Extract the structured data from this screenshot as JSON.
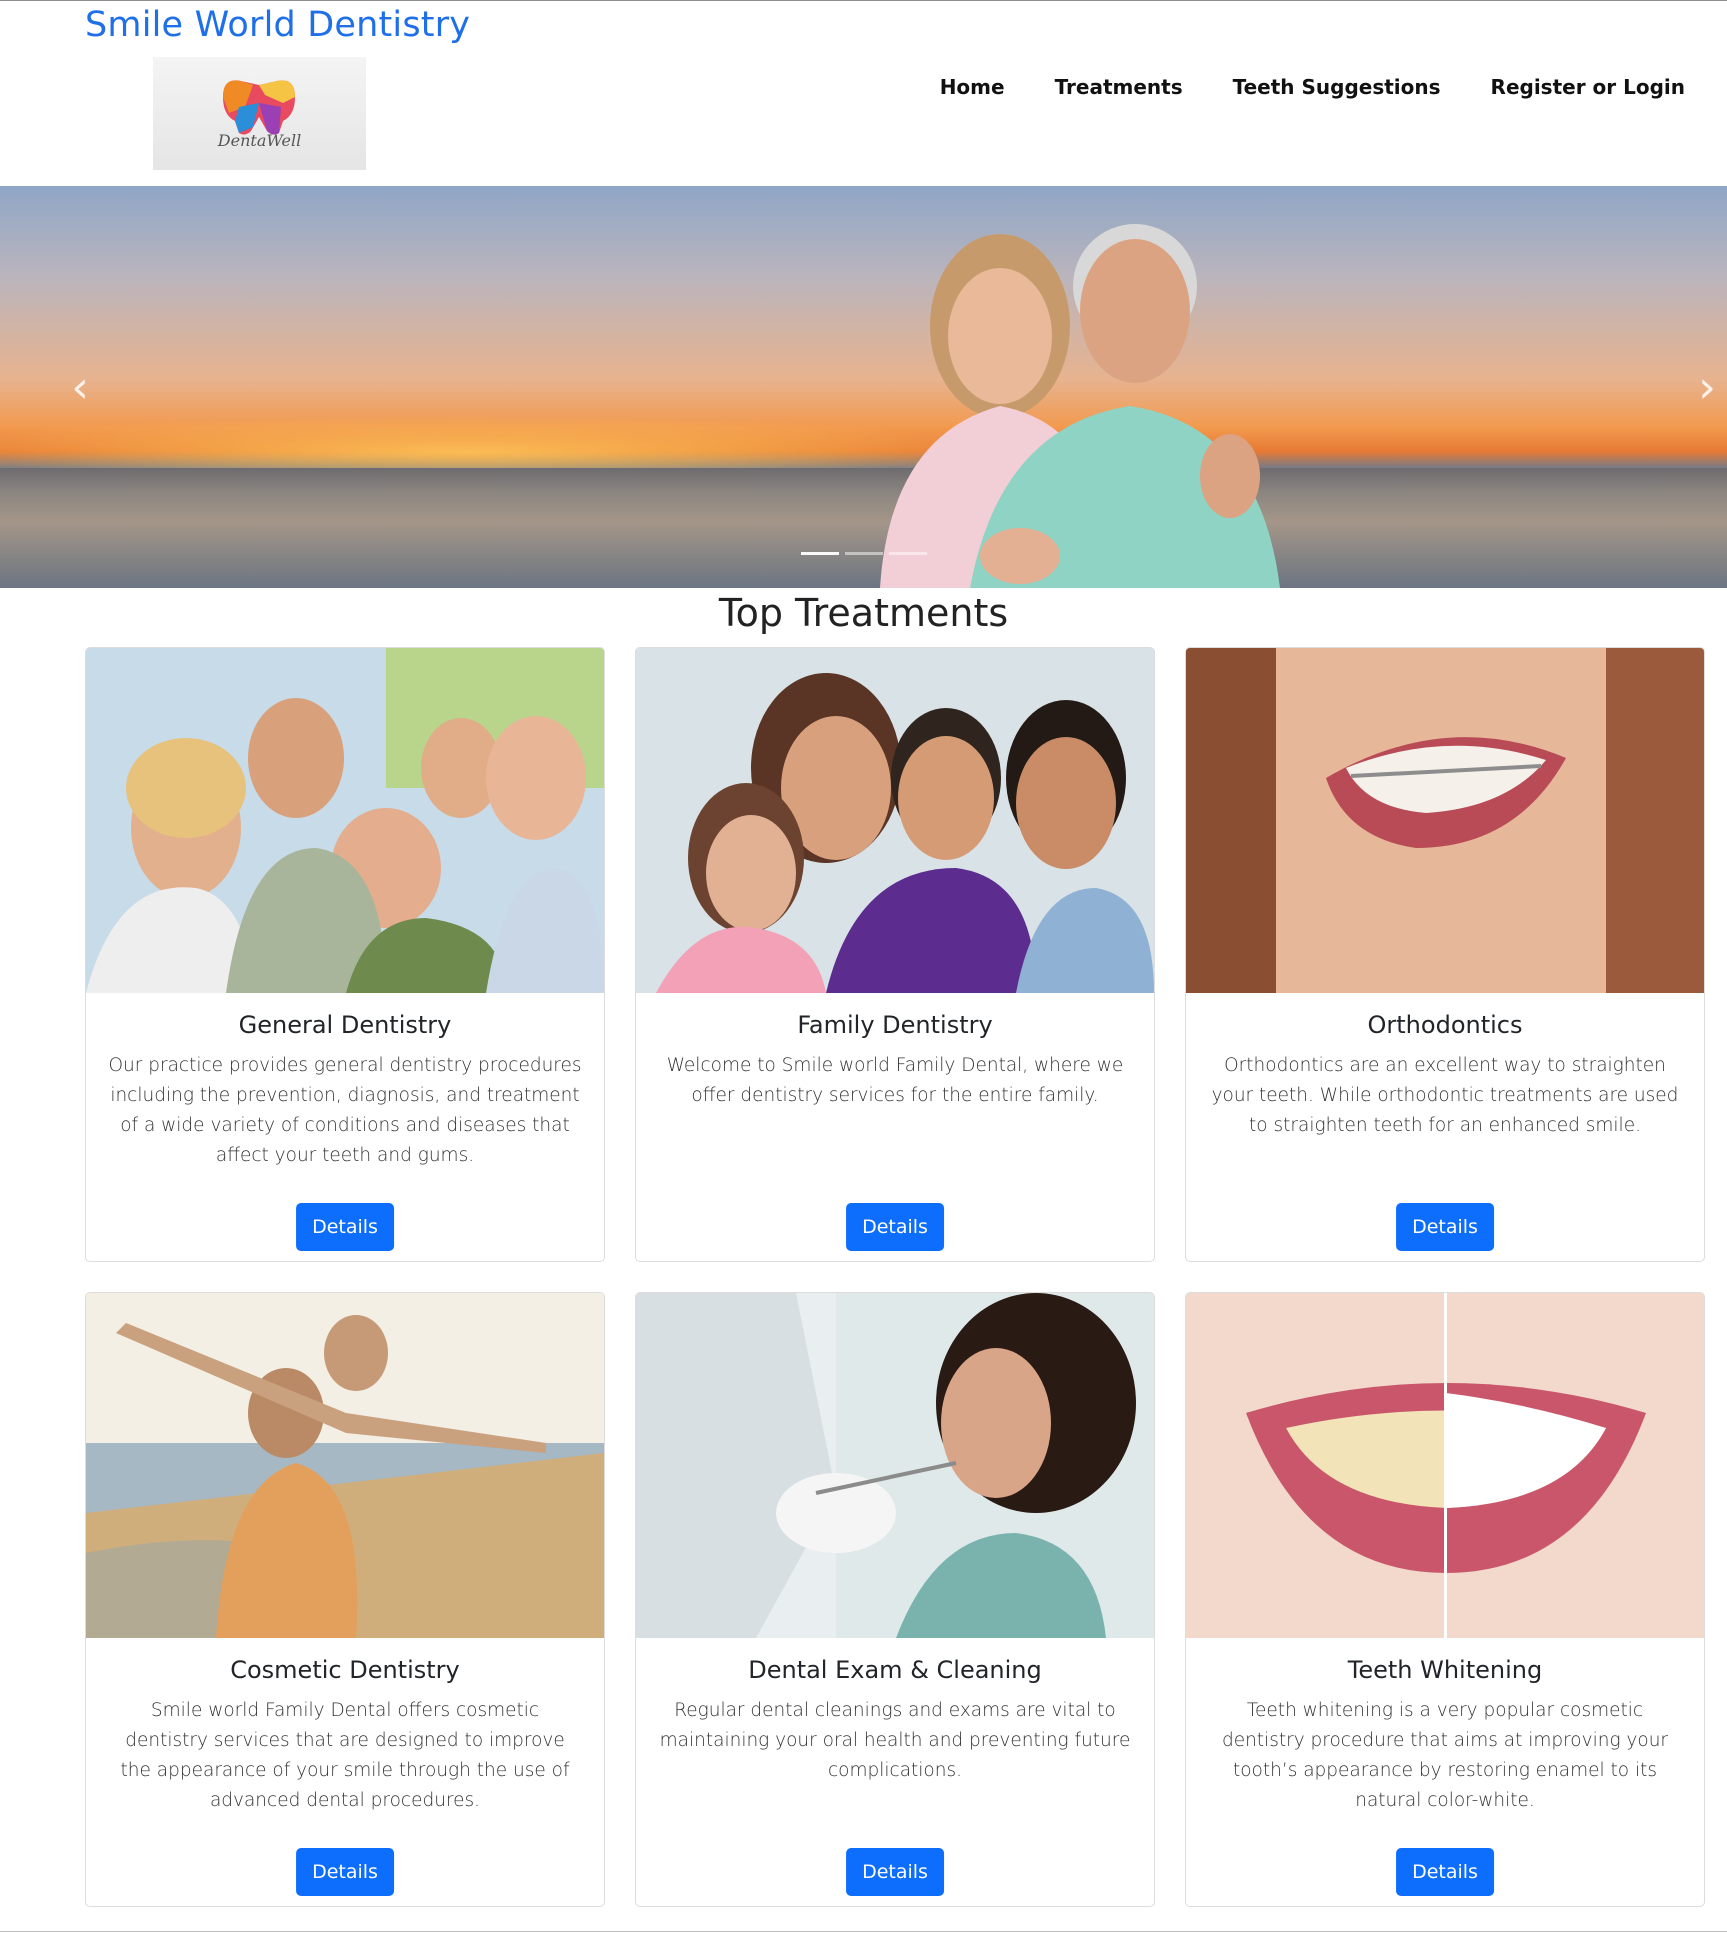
{
  "header": {
    "site_title": "Smile World Dentistry",
    "logo_text": "DentaWell"
  },
  "nav": {
    "items": [
      {
        "label": "Home"
      },
      {
        "label": "Treatments"
      },
      {
        "label": "Teeth Suggestions"
      },
      {
        "label": "Register or Login"
      }
    ]
  },
  "hero": {
    "prev_icon": "chevron-left-icon",
    "next_icon": "chevron-right-icon",
    "slides": 3,
    "active_slide": 1
  },
  "main": {
    "section_title": "Top Treatments",
    "cards": [
      {
        "title": "General Dentistry",
        "text": "Our practice provides general dentistry procedures including the prevention, diagnosis, and treatment of a wide variety of conditions and diseases that affect your teeth and gums.",
        "button": "Details"
      },
      {
        "title": "Family Dentistry",
        "text": "Welcome to Smile world Family Dental, where we offer dentistry services for the entire family.",
        "button": "Details"
      },
      {
        "title": "Orthodontics",
        "text": "Orthodontics are an excellent way to straighten your teeth. While orthodontic treatments are used to straighten teeth for an enhanced smile.",
        "button": "Details"
      },
      {
        "title": "Cosmetic Dentistry",
        "text": "Smile world Family Dental offers cosmetic dentistry services that are designed to improve the appearance of your smile through the use of advanced dental procedures.",
        "button": "Details"
      },
      {
        "title": "Dental Exam & Cleaning",
        "text": "Regular dental cleanings and exams are vital to maintaining your oral health and preventing future complications.",
        "button": "Details"
      },
      {
        "title": "Teeth Whitening",
        "text": "Teeth whitening is a very popular cosmetic dentistry procedure that aims at improving your tooth’s appearance by restoring enamel to its natural color-white.",
        "button": "Details"
      }
    ]
  },
  "colors": {
    "brand": "#1f6fe8",
    "button": "#0d6efd"
  }
}
